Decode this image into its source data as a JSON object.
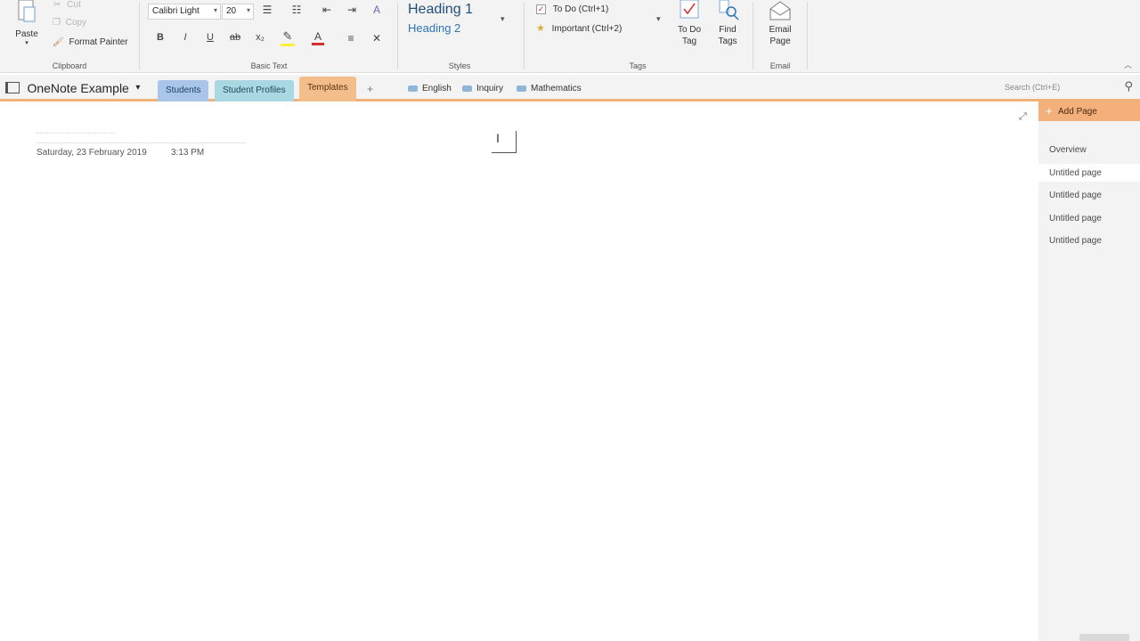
{
  "ribbon": {
    "clipboard": {
      "paste": "Paste",
      "cut": "Cut",
      "copy": "Copy",
      "format_painter": "Format Painter",
      "group_label": "Clipboard"
    },
    "basic_text": {
      "font_name": "Calibri Light",
      "font_size": "20",
      "group_label": "Basic Text"
    },
    "styles": {
      "heading1": "Heading 1",
      "heading2": "Heading 2",
      "group_label": "Styles"
    },
    "tags": {
      "todo": "To Do (Ctrl+1)",
      "important": "Important (Ctrl+2)",
      "todo_tag": "To Do Tag",
      "find_tags": "Find Tags",
      "group_label": "Tags"
    },
    "email": {
      "email_page": "Email Page",
      "group_label": "Email"
    }
  },
  "nav": {
    "notebook": "OneNote Example",
    "tabs": [
      {
        "label": "Students",
        "color": "#a9c6ea"
      },
      {
        "label": "Student Profiles",
        "color": "#a9d8e3"
      },
      {
        "label": "Templates",
        "color": "#f3be8b"
      }
    ],
    "add_tab": "+",
    "sections": [
      "English",
      "Inquiry",
      "Mathematics"
    ],
    "search_placeholder": "Search (Ctrl+E)"
  },
  "page": {
    "date": "Saturday, 23 February 2019",
    "time": "3:13 PM"
  },
  "pages_panel": {
    "add_page": "Add Page",
    "items": [
      "Overview",
      "Untitled page",
      "Untitled page",
      "Untitled page",
      "Untitled page"
    ]
  },
  "colors": {
    "accent": "#f0b27a",
    "ribbon_bg": "#f3f3f3",
    "heading_blue": "#2e75b6"
  }
}
